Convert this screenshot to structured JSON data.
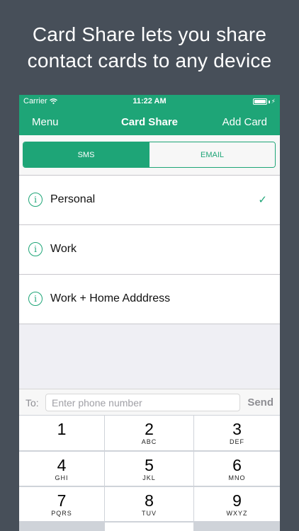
{
  "promo": {
    "line1": "Card Share lets you share",
    "line2": "contact cards to any device"
  },
  "status": {
    "carrier": "Carrier",
    "time": "11:22 AM"
  },
  "nav": {
    "menu": "Menu",
    "title": "Card Share",
    "add": "Add Card"
  },
  "segments": {
    "sms": "SMS",
    "email": "EMAIL"
  },
  "cards": [
    {
      "label": "Personal",
      "selected": true
    },
    {
      "label": "Work",
      "selected": false
    },
    {
      "label": "Work + Home Adddress",
      "selected": false
    }
  ],
  "compose": {
    "to_label": "To:",
    "placeholder": "Enter phone number",
    "send": "Send"
  },
  "keypad": [
    {
      "num": "1",
      "letters": ""
    },
    {
      "num": "2",
      "letters": "ABC"
    },
    {
      "num": "3",
      "letters": "DEF"
    },
    {
      "num": "4",
      "letters": "GHI"
    },
    {
      "num": "5",
      "letters": "JKL"
    },
    {
      "num": "6",
      "letters": "MNO"
    },
    {
      "num": "7",
      "letters": "PQRS"
    },
    {
      "num": "8",
      "letters": "TUV"
    },
    {
      "num": "9",
      "letters": "WXYZ"
    }
  ],
  "colors": {
    "accent": "#1ea577",
    "background": "#474f59"
  }
}
